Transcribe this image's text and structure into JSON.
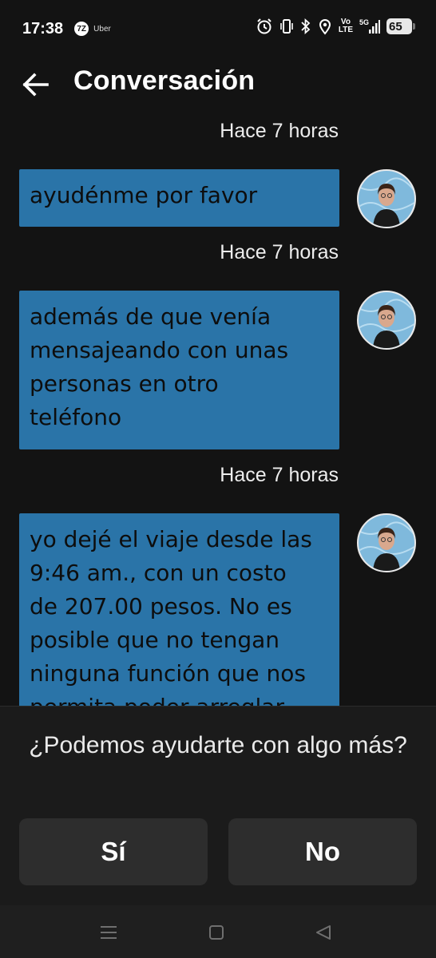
{
  "status_bar": {
    "time": "17:38",
    "app_logo_text": "7Z",
    "app_name": "Uber",
    "volte": "Vo\nLTE",
    "network": "5G",
    "battery": "65",
    "icons": [
      "alarm-icon",
      "vibrate-icon",
      "bluetooth-icon",
      "location-icon",
      "volte-icon",
      "signal-icon",
      "battery-icon"
    ]
  },
  "header": {
    "back_icon": "arrow-left-icon",
    "title": "Conversación"
  },
  "messages": [
    {
      "timestamp": "Hace 7 horas",
      "text": "ayudénme por favor"
    },
    {
      "timestamp": "Hace 7 horas",
      "text": "además de que venía\nmensajeando con unas\npersonas en otro\nteléfono"
    },
    {
      "timestamp": "Hace 7 horas",
      "text": "yo dejé el viaje desde las\n9:46 am., con un costo\nde 207.00 pesos. No es\nposible que no tengan\nninguna función que nos\npermita poder arreglar"
    }
  ],
  "feedback": {
    "question": "¿Podemos ayudarte con algo más?",
    "yes_label": "Sí",
    "no_label": "No"
  },
  "nav_bar": {
    "icons": [
      "menu-icon",
      "home-icon",
      "back-triangle-icon"
    ]
  },
  "colors": {
    "background": "#131313",
    "bubble": "#2a74a8",
    "sheet": "#1b1b1b",
    "button": "#2d2d2d"
  }
}
